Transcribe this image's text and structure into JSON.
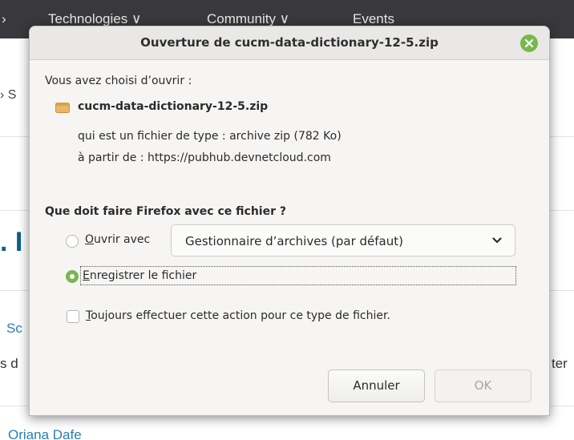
{
  "background": {
    "nav_items": [
      "Technologies ∨",
      "Community ∨",
      "Events"
    ],
    "fragments": [
      "› S",
      ". I",
      "Sc",
      "s d",
      "ter",
      "Oriana Dafe"
    ]
  },
  "dialog": {
    "title": "Ouverture de cucm-data-dictionary-12-5.zip",
    "intro": "Vous avez choisi d’ouvrir :",
    "file_name": "cucm-data-dictionary-12-5.zip",
    "file_type_label": "qui est un fichier de type :",
    "file_type_value": "archive zip (782 Ko)",
    "source_label": "à partir de :",
    "source_value": "https://pubhub.devnetcloud.com",
    "question": "Que doit faire Firefox avec ce fichier ?",
    "open_with": {
      "label_first": "O",
      "label_rest": "uvrir avec",
      "selected_app": "Gestionnaire d’archives (par défaut)"
    },
    "save_file": {
      "label_first": "E",
      "label_rest": "nregistrer le fichier"
    },
    "always_do": {
      "label_first": "T",
      "label_rest": "oujours effectuer cette action pour ce type de fichier."
    },
    "buttons": {
      "cancel": "Annuler",
      "ok": "OK"
    }
  },
  "colors": {
    "accent_green": "#7ab553",
    "close_green": "#76b94c",
    "nav_bg": "#39393d"
  },
  "icons": [
    "close-icon",
    "archive-file-icon",
    "chevron-down-icon"
  ]
}
